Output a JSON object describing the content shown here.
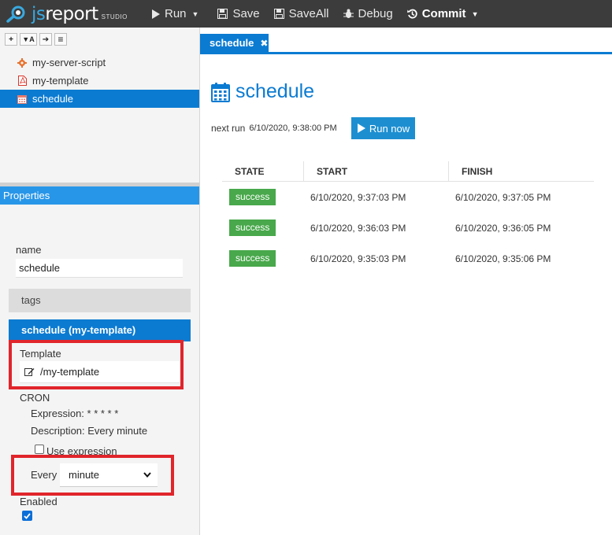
{
  "app": {
    "logo_main": "jsreport",
    "logo_sub": "STUDIO"
  },
  "toolbar": {
    "run_label": "Run",
    "save_label": "Save",
    "saveall_label": "SaveAll",
    "debug_label": "Debug",
    "commit_label": "Commit"
  },
  "tree_toolbar": {
    "add": "+",
    "filter": "▼A",
    "arrow": "➔",
    "menu": "≡"
  },
  "tree": {
    "items": [
      {
        "label": "my-server-script",
        "icon": "gear-icon"
      },
      {
        "label": "my-template",
        "icon": "pdf-file-icon"
      },
      {
        "label": "schedule",
        "icon": "calendar-icon"
      }
    ]
  },
  "properties": {
    "header": "Properties",
    "name_label": "name",
    "name_value": "schedule",
    "tags_label": "tags",
    "schedule_section": "schedule (my-template)",
    "template_label": "Template",
    "template_value": "/my-template",
    "cron_label": "CRON",
    "expression": "Expression: * * * * *",
    "description": "Description: Every minute",
    "use_expression_label": "Use expression",
    "use_expression_checked": false,
    "every_label": "Every",
    "every_value": "minute",
    "enabled_label": "Enabled",
    "enabled_checked": true
  },
  "tabs": [
    {
      "label": "schedule",
      "close": "✖"
    }
  ],
  "main": {
    "title": "schedule",
    "next_run_label": "next run",
    "next_run_value": "6/10/2020, 9:38:00 PM",
    "run_now_label": "Run now",
    "history": {
      "columns": [
        "STATE",
        "START",
        "FINISH"
      ],
      "rows": [
        {
          "state": "success",
          "start": "6/10/2020, 9:37:03 PM",
          "finish": "6/10/2020, 9:37:05 PM"
        },
        {
          "state": "success",
          "start": "6/10/2020, 9:36:03 PM",
          "finish": "6/10/2020, 9:36:05 PM"
        },
        {
          "state": "success",
          "start": "6/10/2020, 9:35:03 PM",
          "finish": "6/10/2020, 9:35:06 PM"
        }
      ]
    }
  },
  "colors": {
    "accent": "#0b7bd2",
    "success": "#48a84b",
    "highlight": "#e0252b",
    "topbar": "#3c3c3c"
  }
}
